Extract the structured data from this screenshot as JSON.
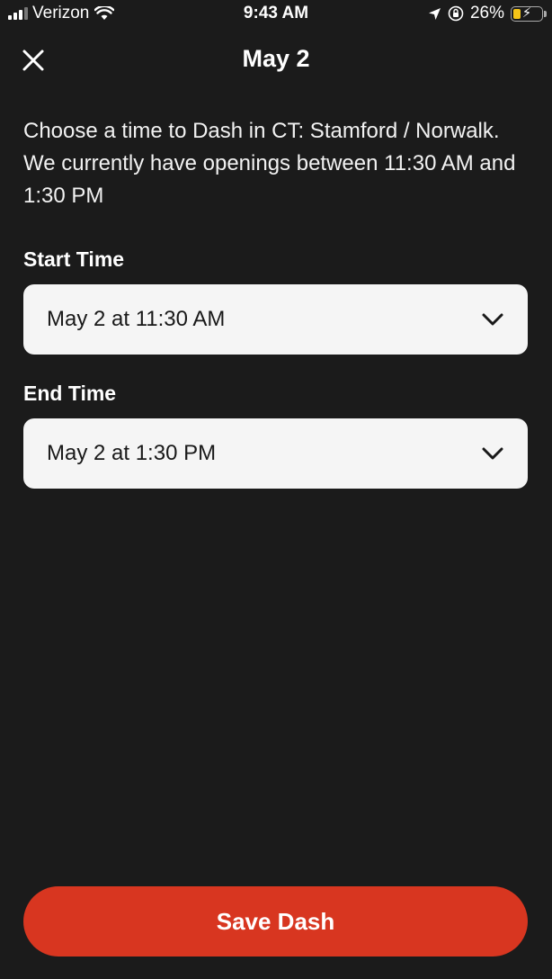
{
  "status_bar": {
    "carrier": "Verizon",
    "time": "9:43 AM",
    "battery_percent": "26%",
    "battery_level": 0.26,
    "icons": [
      "signal-icon",
      "wifi-icon",
      "location-icon",
      "orientation-lock-icon",
      "battery-icon"
    ]
  },
  "header": {
    "title": "May 2",
    "close_icon": "close-icon"
  },
  "description": "Choose a time to Dash in CT: Stamford / Norwalk. We currently have openings between 11:30 AM and 1:30 PM",
  "start_time": {
    "label": "Start Time",
    "value": "May 2 at 11:30 AM"
  },
  "end_time": {
    "label": "End Time",
    "value": "May 2 at 1:30 PM"
  },
  "save_button": {
    "label": "Save Dash"
  },
  "colors": {
    "background": "#1b1b1b",
    "accent": "#d83620",
    "field_background": "#f5f5f5",
    "battery": "#f5c518"
  }
}
